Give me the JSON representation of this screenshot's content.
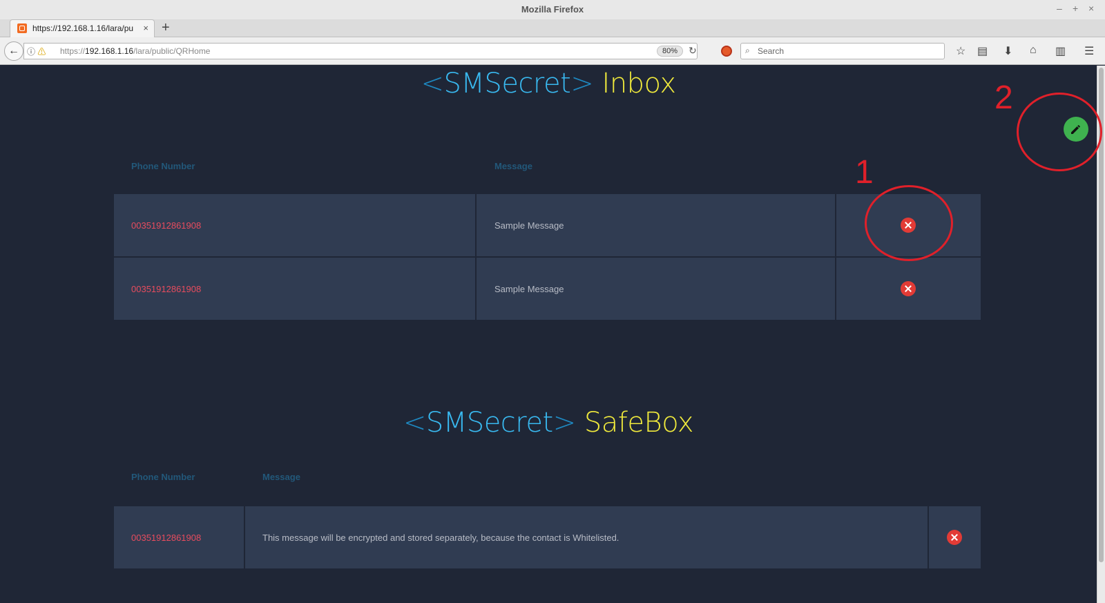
{
  "window": {
    "title": "Mozilla Firefox",
    "controls": [
      "–",
      "+",
      "×"
    ]
  },
  "tab": {
    "title": "https://192.168.1.16/lara/pu",
    "close": "×",
    "new": "+"
  },
  "navbar": {
    "back": "←",
    "info": "ⓘ",
    "url_scheme": "https://",
    "url_host": "192.168.1.16",
    "url_path": "/lara/public/QRHome",
    "zoom": "80%",
    "reload": "↻",
    "search_placeholder": "Search",
    "icons": [
      "star-icon",
      "reading-list-icon",
      "download-icon",
      "home-icon",
      "pocket-icon",
      "menu-icon"
    ]
  },
  "inbox": {
    "title_open": "<",
    "brand": "SMSecret",
    "title_close": ">",
    "word": "Inbox",
    "columns": [
      "Phone Number",
      "Message"
    ],
    "rows": [
      {
        "phone": "00351912861908",
        "message": "Sample Message"
      },
      {
        "phone": "00351912861908",
        "message": "Sample Message"
      }
    ]
  },
  "safebox": {
    "title_open": "<",
    "brand": "SMSecret",
    "title_close": ">",
    "word": "SafeBox",
    "columns": [
      "Phone Number",
      "Message"
    ],
    "rows": [
      {
        "phone": "00351912861908",
        "message": "This message will be encrypted and stored separately, because the contact is Whitelisted."
      }
    ]
  },
  "annotations": [
    "1",
    "2"
  ],
  "colors": {
    "brand": "#39b9f0",
    "accent": "#f0ea3c",
    "phone": "#e84c5e",
    "delete": "#e23b36",
    "edit": "#3fb24f",
    "annotation": "#e0202a"
  }
}
